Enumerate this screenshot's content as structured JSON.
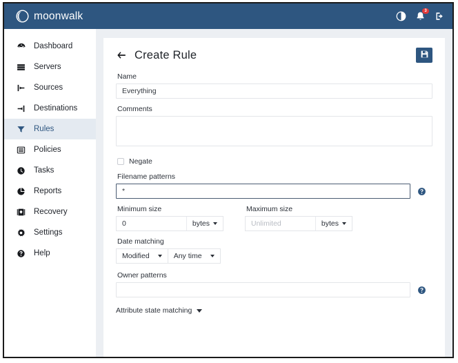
{
  "app": {
    "brand": "moonwalk",
    "logo_icon": "moon-crescent-icon"
  },
  "topbar": {
    "theme_toggle_icon": "contrast-circle-icon",
    "notifications_icon": "bell-icon",
    "notifications_count": "3",
    "logout_icon": "sign-out-icon"
  },
  "sidebar": {
    "items": [
      {
        "label": "Dashboard",
        "icon": "gauge-icon",
        "active": false
      },
      {
        "label": "Servers",
        "icon": "server-icon",
        "active": false
      },
      {
        "label": "Sources",
        "icon": "sign-out-icon",
        "active": false
      },
      {
        "label": "Destinations",
        "icon": "sign-in-icon",
        "active": false
      },
      {
        "label": "Rules",
        "icon": "filter-icon",
        "active": true
      },
      {
        "label": "Policies",
        "icon": "list-icon",
        "active": false
      },
      {
        "label": "Tasks",
        "icon": "clock-icon",
        "active": false
      },
      {
        "label": "Reports",
        "icon": "pie-chart-icon",
        "active": false
      },
      {
        "label": "Recovery",
        "icon": "safe-vault-icon",
        "active": false
      },
      {
        "label": "Settings",
        "icon": "gear-icon",
        "active": false
      },
      {
        "label": "Help",
        "icon": "question-circle-icon",
        "active": false
      }
    ]
  },
  "page": {
    "back_icon": "arrow-left-icon",
    "title": "Create Rule",
    "save_icon": "floppy-save-icon"
  },
  "form": {
    "name": {
      "label": "Name",
      "value": "Everything",
      "placeholder": ""
    },
    "comments": {
      "label": "Comments",
      "value": "",
      "placeholder": ""
    },
    "negate": {
      "label": "Negate",
      "checked": false
    },
    "filename_patterns": {
      "label": "Filename patterns",
      "value": "*",
      "placeholder": "",
      "focused": true,
      "help_icon": "question-circle-icon"
    },
    "minimum_size": {
      "label": "Minimum size",
      "value": "0",
      "placeholder": "",
      "unit": "bytes"
    },
    "maximum_size": {
      "label": "Maximum size",
      "value": "",
      "placeholder": "Unlimited",
      "unit": "bytes"
    },
    "date_matching": {
      "label": "Date matching",
      "field": "Modified",
      "range": "Any time"
    },
    "owner_patterns": {
      "label": "Owner patterns",
      "value": "",
      "placeholder": "",
      "help_icon": "question-circle-icon"
    },
    "attribute_state": {
      "label": "Attribute state matching",
      "chevron_icon": "chevron-down-icon"
    }
  },
  "colors": {
    "brand_blue": "#2e5680",
    "active_nav_bg": "#e4eaf1",
    "badge_red": "#e23b3b",
    "page_bg": "#eceff3"
  }
}
